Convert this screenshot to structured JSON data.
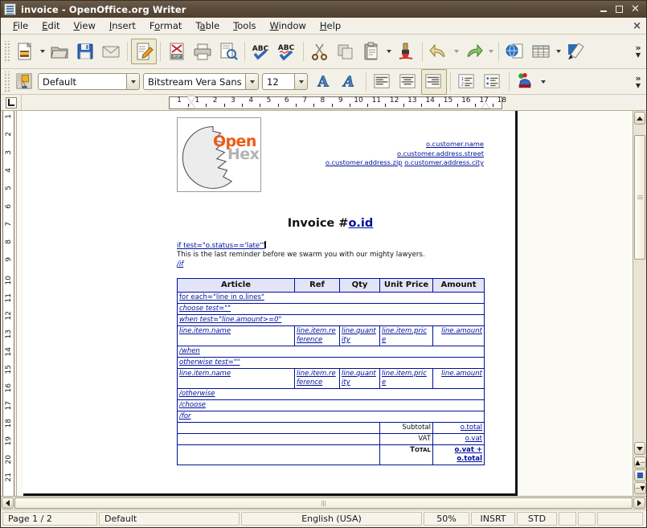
{
  "window": {
    "title": "invoice - OpenOffice.org Writer",
    "icon": "writer-document-icon",
    "minimize_label": "Minimize",
    "maximize_label": "Maximize",
    "close_label": "Close"
  },
  "menubar": {
    "items": [
      {
        "label": "File",
        "mnemonic": "F"
      },
      {
        "label": "Edit",
        "mnemonic": "E"
      },
      {
        "label": "View",
        "mnemonic": "V"
      },
      {
        "label": "Insert",
        "mnemonic": "I"
      },
      {
        "label": "Format",
        "mnemonic": "o"
      },
      {
        "label": "Table",
        "mnemonic": "a"
      },
      {
        "label": "Tools",
        "mnemonic": "T"
      },
      {
        "label": "Window",
        "mnemonic": "W"
      },
      {
        "label": "Help",
        "mnemonic": "H"
      }
    ],
    "close_document_label": "×"
  },
  "standard_toolbar": {
    "overflow_label": "»",
    "buttons": [
      {
        "name": "new-document-icon",
        "label": "New"
      },
      {
        "name": "new-document-dropdown",
        "label": "New dropdown"
      },
      {
        "name": "open-folder-icon",
        "label": "Open"
      },
      {
        "name": "save-floppy-icon",
        "label": "Save"
      },
      {
        "name": "email-envelope-icon",
        "label": "Document as E-mail"
      },
      {
        "name": "edit-file-pencil-icon",
        "label": "Edit File"
      },
      {
        "name": "export-pdf-icon",
        "label": "Export Directly as PDF"
      },
      {
        "name": "print-icon",
        "label": "Print File Directly"
      },
      {
        "name": "print-preview-icon",
        "label": "Page Preview"
      },
      {
        "name": "spelling-check-icon",
        "label": "Spelling and Grammar"
      },
      {
        "name": "autospellcheck-icon",
        "label": "AutoSpellcheck"
      },
      {
        "name": "cut-scissors-icon",
        "label": "Cut"
      },
      {
        "name": "copy-icon",
        "label": "Copy"
      },
      {
        "name": "paste-clipboard-icon",
        "label": "Paste"
      },
      {
        "name": "paste-dropdown",
        "label": "Paste dropdown"
      },
      {
        "name": "clone-formatting-brush-icon",
        "label": "Clone Formatting"
      },
      {
        "name": "undo-icon",
        "label": "Undo"
      },
      {
        "name": "undo-dropdown",
        "label": "Undo dropdown"
      },
      {
        "name": "redo-icon",
        "label": "Redo"
      },
      {
        "name": "redo-dropdown",
        "label": "Redo dropdown"
      },
      {
        "name": "hyperlink-globe-icon",
        "label": "Hyperlink"
      },
      {
        "name": "insert-table-icon",
        "label": "Table"
      },
      {
        "name": "insert-table-dropdown",
        "label": "Table dropdown"
      },
      {
        "name": "show-draw-functions-icon",
        "label": "Show Draw Functions"
      }
    ]
  },
  "formatting_toolbar": {
    "overflow_label": "»",
    "paragraph_style": "Default",
    "font_name": "Bitstream Vera Sans",
    "font_size": "12",
    "bold_label": "A",
    "italic_label": "A",
    "buttons": [
      {
        "name": "apply-style-icon",
        "label": "Apply Style"
      },
      {
        "name": "bold-icon",
        "label": "Bold"
      },
      {
        "name": "italic-icon",
        "label": "Italic"
      },
      {
        "name": "align-left-icon",
        "label": "Align Left"
      },
      {
        "name": "align-center-icon",
        "label": "Centered"
      },
      {
        "name": "align-right-icon",
        "label": "Align Right",
        "active": true
      },
      {
        "name": "numbering-on-off-icon",
        "label": "Numbering On/Off"
      },
      {
        "name": "bullets-on-off-icon",
        "label": "Bullets On/Off"
      },
      {
        "name": "highlighting-color-icon",
        "label": "Highlighting"
      },
      {
        "name": "highlighting-dropdown",
        "label": "Highlighting dropdown"
      }
    ]
  },
  "ruler": {
    "corner_tab_label": "L",
    "horizontal_ticks": [
      "1",
      "1",
      "2",
      "3",
      "4",
      "5",
      "6",
      "7",
      "8",
      "9",
      "10",
      "11",
      "12",
      "13",
      "14",
      "15",
      "16",
      "17",
      "18"
    ],
    "vertical_ticks": [
      "1",
      "2",
      "3",
      "4",
      "5",
      "6",
      "7",
      "8",
      "9",
      "10",
      "11",
      "12",
      "13",
      "14",
      "15",
      "16",
      "17",
      "18",
      "19",
      "20",
      "21"
    ]
  },
  "document": {
    "logo": {
      "word_one": "Open",
      "word_two": "Hex",
      "color_one": "#f05a14",
      "color_two": "#b3b3b3"
    },
    "address_fields": [
      "o.customer.name",
      "o.customer.address.street"
    ],
    "address_last_line": [
      "o.customer.address.zip",
      "o.customer.address.city"
    ],
    "title_prefix": "Invoice #",
    "title_field": "o.id",
    "condition_open": "if test=\"o.status=='late'\"",
    "reminder_text": "This is the last reminder before we swarm you with our mighty lawyers.",
    "condition_close": "/if",
    "table": {
      "headers": [
        "Article",
        "Ref",
        "Qty",
        "Unit Price",
        "Amount"
      ],
      "rows": [
        {
          "kind": "tag",
          "text": "for each=\"line in o.lines\"",
          "italic": false
        },
        {
          "kind": "tag",
          "text": "choose test=\"\"",
          "italic": true
        },
        {
          "kind": "tag",
          "text": "when test=\"line.amount>=0\"",
          "italic": true
        },
        {
          "kind": "data",
          "cells": [
            "line.item.name",
            "line.item.reference",
            "line.quantity",
            "line.item.price",
            "line.amount"
          ]
        },
        {
          "kind": "tag",
          "text": "/when",
          "italic": true
        },
        {
          "kind": "tag",
          "text": "otherwise test=\"\"",
          "italic": true
        },
        {
          "kind": "data",
          "cells": [
            "line.item.name",
            "line.item.reference",
            "line.quantity",
            "line.item.price",
            "line.amount"
          ]
        },
        {
          "kind": "tag",
          "text": "/otherwise",
          "italic": true
        },
        {
          "kind": "tag",
          "text": "/choose",
          "italic": true
        },
        {
          "kind": "tag",
          "text": "/for",
          "italic": true
        }
      ],
      "totals": [
        {
          "label": "Subtotal",
          "value": "o.total",
          "bold": false
        },
        {
          "label": "VAT",
          "value": "o.vat",
          "bold": false
        },
        {
          "label": "Total",
          "value": "o.vat + o.total",
          "bold": true
        }
      ]
    }
  },
  "scrollbars": {
    "previous_page_label": "Previous Page",
    "navigator_label": "Navigation",
    "next_page_label": "Next Page"
  },
  "statusbar": {
    "page": "Page 1 / 2",
    "page_style": "Default",
    "language": "English (USA)",
    "zoom": "50%",
    "insert_mode": "INSRT",
    "selection_mode": "STD",
    "modified": "",
    "signature": ""
  },
  "colors": {
    "field_blue": "#00109b",
    "table_header_bg": "#e4e4f8",
    "titlebar": "#5a4b3b",
    "toolbar_bg": "#f3f1e7"
  }
}
